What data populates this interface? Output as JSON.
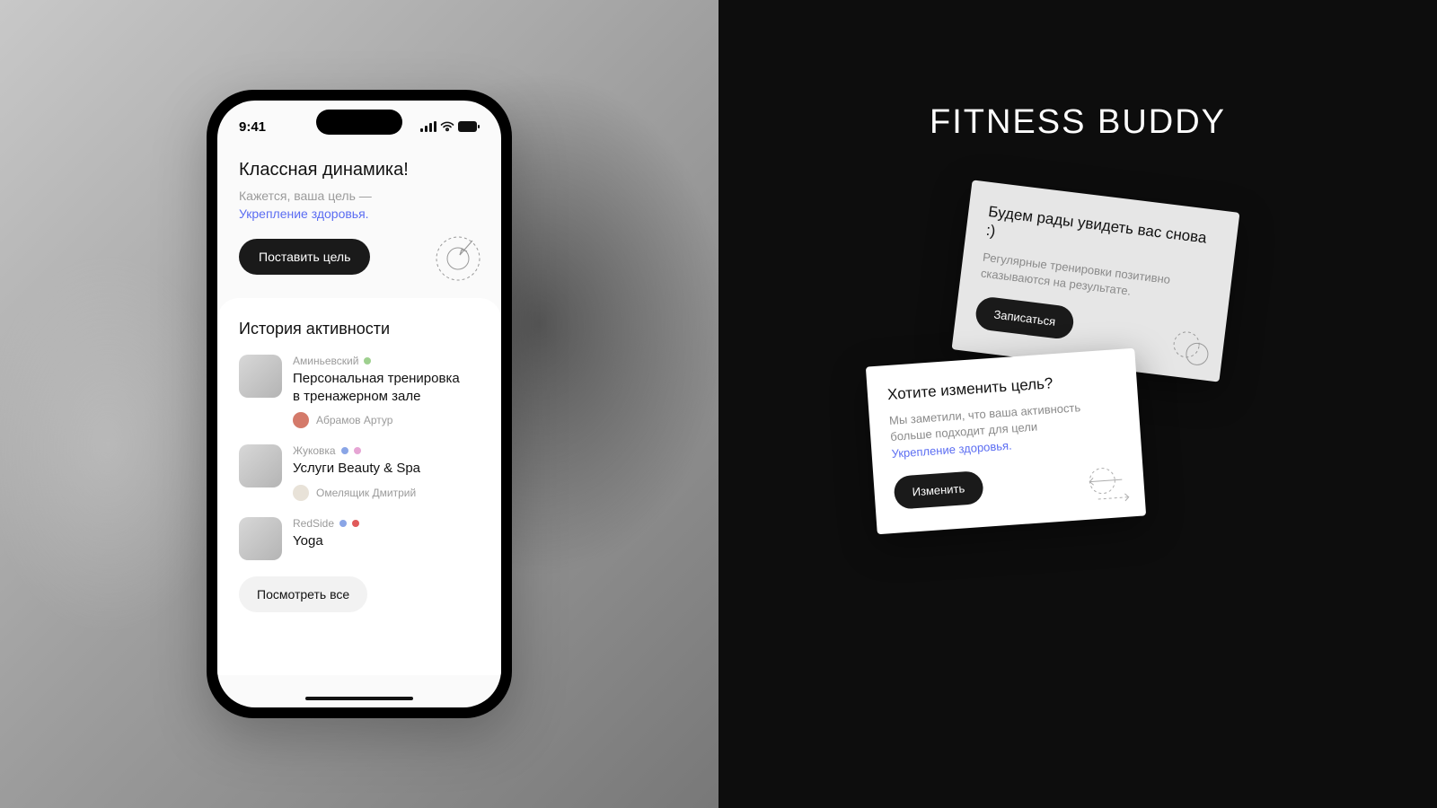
{
  "left": {
    "statusbar": {
      "time": "9:41"
    },
    "hero": {
      "title": "Классная динамика!",
      "subtitle_prefix": "Кажется, ваша цель —",
      "subtitle_link": "Укрепление здоровья.",
      "button": "Поставить цель"
    },
    "history": {
      "title": "История активности",
      "see_all": "Посмотреть все",
      "items": [
        {
          "location": "Аминьевский",
          "name_line1": "Персональная тренировка",
          "name_line2": "в тренажерном зале",
          "trainer": "Абрамов Артур"
        },
        {
          "location": "Жуковка",
          "name_line1": "Услуги Beauty & Spa",
          "name_line2": "",
          "trainer": "Омелящик Дмитрий"
        },
        {
          "location": "RedSide",
          "name_line1": "Yoga",
          "name_line2": "",
          "trainer": ""
        }
      ]
    }
  },
  "right": {
    "brand": "FITNESS BUDDY",
    "card_back": {
      "title": "Будем рады увидеть вас снова :)",
      "subtitle": "Регулярные тренировки позитивно сказываются на результате.",
      "button": "Записаться"
    },
    "card_front": {
      "title": "Хотите изменить цель?",
      "subtitle_prefix": "Мы заметили, что ваша активность больше подходит для цели",
      "subtitle_link": "Укрепление здоровья.",
      "button": "Изменить"
    }
  }
}
